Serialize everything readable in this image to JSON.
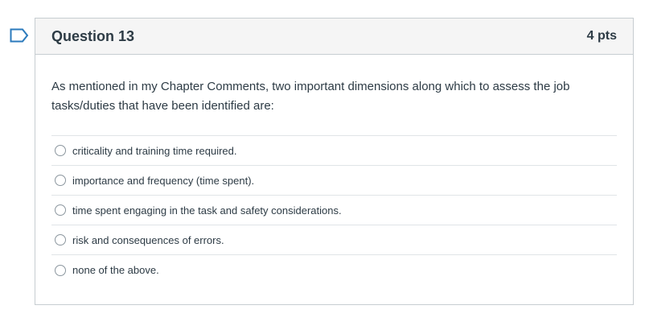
{
  "question": {
    "title": "Question 13",
    "points": "4 pts",
    "text": "As mentioned in my Chapter Comments, two important dimensions along which to assess the job tasks/duties that have been identified are:",
    "answers": [
      {
        "label": "criticality and training time required."
      },
      {
        "label": "importance and frequency (time spent)."
      },
      {
        "label": "time spent engaging in the task and safety considerations."
      },
      {
        "label": "risk and consequences of errors."
      },
      {
        "label": "none of the above."
      }
    ]
  },
  "colors": {
    "flag": "#2b7abc",
    "header_bg": "#f5f5f5",
    "border": "#c7cdd1",
    "text": "#2d3b45"
  },
  "icons": {
    "flag": "bookmark-flag-icon",
    "radio": "radio-unchecked-icon"
  }
}
